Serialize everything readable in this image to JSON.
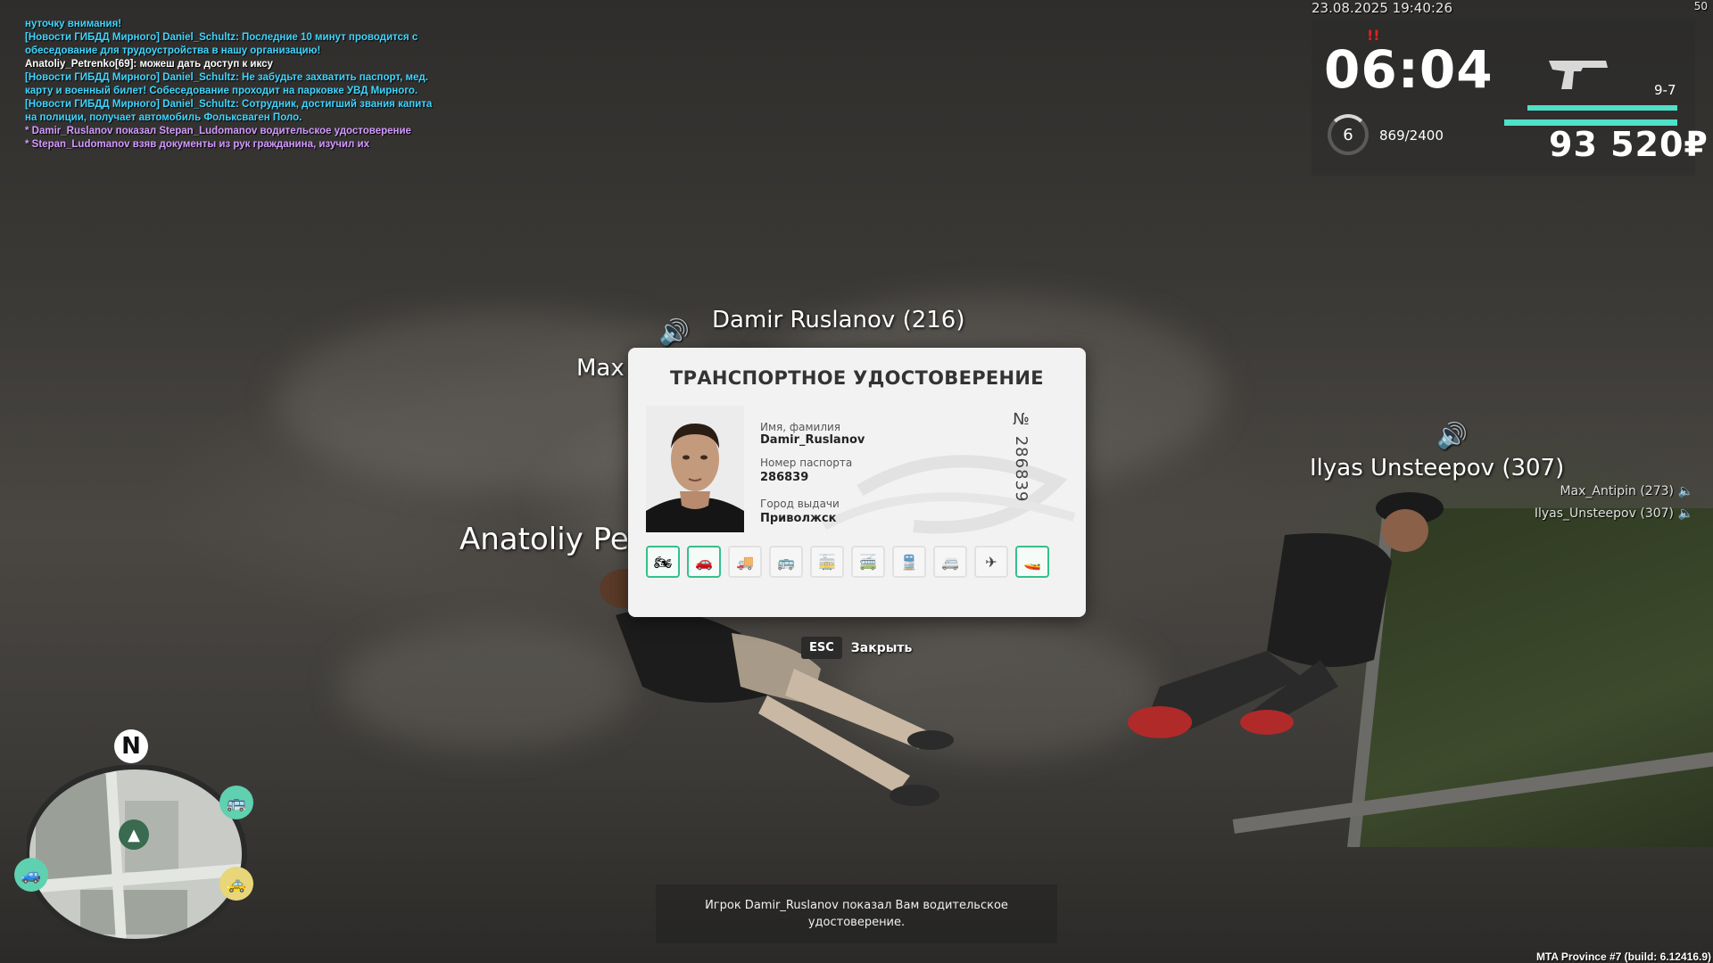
{
  "chat": [
    {
      "text": "нуточку внимания!",
      "color": "cyan"
    },
    {
      "text": "[Новости ГИБДД Мирного] Daniel_Schultz: Последние 10 минут проводится с",
      "color": "cyan"
    },
    {
      "text": "обеседование для трудоустройства в нашу организацию!",
      "color": "cyan"
    },
    {
      "text": "Anatoliy_Petrenko[69]: можеш дать доступ к иксу",
      "color": "white"
    },
    {
      "text": "[Новости ГИБДД Мирного] Daniel_Schultz: Не забудьте захватить паспорт, мед.",
      "color": "cyan"
    },
    {
      "text": "карту и военный билет! Собеседование проходит на парковке УВД Мирного.",
      "color": "cyan"
    },
    {
      "text": "[Новости ГИБДД Мирного] Daniel_Schultz: Сотрудник, достигший звания капита",
      "color": "cyan"
    },
    {
      "text": "на полиции, получает автомобиль Фольксваген Поло.",
      "color": "cyan"
    },
    {
      "text": "* Damir_Ruslanov показал Stepan_Ludomanov водительское удостоверение",
      "color": "purple"
    },
    {
      "text": "* Stepan_Ludomanov взяв документы из рук гражданина, изучил их",
      "color": "purple"
    }
  ],
  "hud": {
    "datetime": "23.08.2025 19:40:26",
    "fps": "50",
    "clock": "06:04",
    "wanted": "!!",
    "level": "6",
    "exp": "869/2400",
    "exp_fraction": 0.36,
    "ammo": "9-7",
    "health_fraction": 1.0,
    "armor_fraction": 1.0,
    "money": "93 520₽",
    "accent_color": "#4fe0c8"
  },
  "nametags": {
    "damir": "Damir Ruslanov (216)",
    "max": "Max",
    "anatoliy": "Anatoliy Pet",
    "ilyas": "Ilyas Unsteepov (307)"
  },
  "voice_list": [
    "Max_Antipin (273)",
    "Ilyas_Unsteepov (307)"
  ],
  "license": {
    "title": "ТРАНСПОРТНОЕ УДОСТОВЕРЕНИЕ",
    "name_label": "Имя, фамилия",
    "name_value": "Damir_Ruslanov",
    "passport_label": "Номер паспорта",
    "passport_value": "286839",
    "city_label": "Город выдачи",
    "city_value": "Приволжск",
    "number": "№ 286839",
    "categories": [
      {
        "icon": "motorcycle-icon",
        "enabled": true
      },
      {
        "icon": "car-icon",
        "enabled": true
      },
      {
        "icon": "truck-icon",
        "enabled": false
      },
      {
        "icon": "bus-icon",
        "enabled": false
      },
      {
        "icon": "tram-icon",
        "enabled": false
      },
      {
        "icon": "trolleybus-icon",
        "enabled": false
      },
      {
        "icon": "train-icon",
        "enabled": false
      },
      {
        "icon": "van-icon",
        "enabled": false
      },
      {
        "icon": "airplane-icon",
        "enabled": false
      },
      {
        "icon": "boat-icon",
        "enabled": true
      }
    ]
  },
  "close": {
    "key": "ESC",
    "label": "Закрыть"
  },
  "notice": "Игрок Damir_Ruslanov показал Вам водительское удостоверение.",
  "build": "MTA Province #7 (build: 6.12416.9)",
  "minimap": {
    "compass": "N"
  }
}
